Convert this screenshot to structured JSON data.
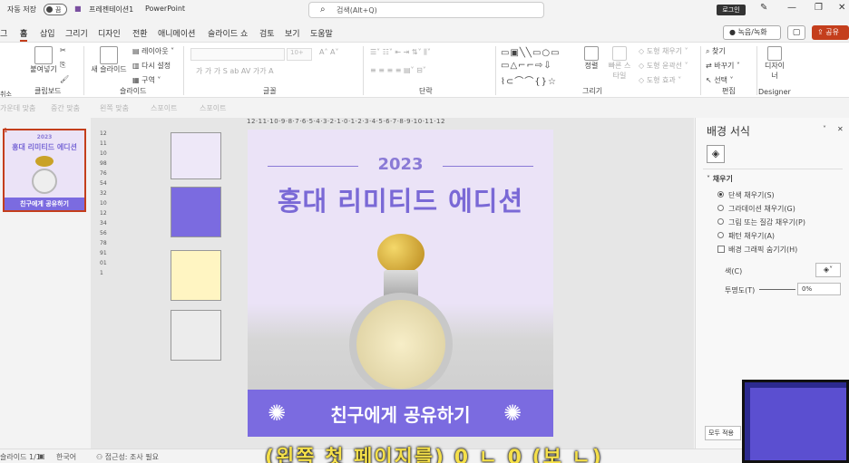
{
  "titlebar": {
    "autosave": "자동 저장",
    "autosave_state": "끔",
    "filename": "프레젠테이션1",
    "app": "PowerPoint",
    "search_placeholder": "검색(Alt+Q)",
    "login": "로그인"
  },
  "tabs": [
    "그",
    "홈",
    "삽입",
    "그리기",
    "디자인",
    "전환",
    "애니메이션",
    "슬라이드 쇼",
    "검토",
    "보기",
    "도움말"
  ],
  "actions": {
    "record": "녹음/녹화",
    "share": "공유"
  },
  "ribbon": {
    "groups": [
      "클립보드",
      "슬라이드",
      "글꼴",
      "단락",
      "그리기",
      "편집",
      "Designer"
    ],
    "clipboard": {
      "paste": "붙여넣기",
      "undo": "취소"
    },
    "slides": {
      "new": "새 슬라이드",
      "layout": "레이아웃",
      "reset": "다시 설정",
      "section": "구역"
    },
    "font": {
      "size": "10+"
    },
    "drawing": {
      "arrange": "정렬",
      "quick_styles": "빠른 스타일",
      "fill": "도형 채우기",
      "outline": "도형 윤곽선",
      "effects": "도형 효과"
    },
    "editing": {
      "find": "찾기",
      "replace": "바꾸기",
      "select": "선택"
    },
    "designer": "디자이너"
  },
  "subbar": [
    "가운데 맞춤",
    "중간 맞춤",
    "왼쪽 맞춤",
    "스포이트",
    "스포이트"
  ],
  "thumb": {
    "number": "1",
    "year": "2023",
    "title": "홍대 리미티드 에디션",
    "cta": "친구에게 공유하기"
  },
  "ruler": {
    "h": "12·11·10·9·8·7·6·5·4·3·2·1·0·1·2·3·4·5·6·7·8·9·10·11·12",
    "v": "12111098765432101234567891011"
  },
  "swatches": [
    "#eee8f8",
    "#7b6be0",
    "#fff5c2",
    "#ececec"
  ],
  "slide": {
    "year": "2023",
    "title": "홍대 리미티드 에디션",
    "cta": "친구에게 공유하기"
  },
  "format_pane": {
    "title": "배경 서식",
    "section": "채우기",
    "options": [
      "단색 채우기(S)",
      "그라데이션 채우기(G)",
      "그림 또는 질감 채우기(P)",
      "패턴 채우기(A)"
    ],
    "hide_graphics": "배경 그래픽 숨기기(H)",
    "color_label": "색(C)",
    "transparency_label": "투명도(T)",
    "transparency_value": "0%",
    "apply_all": "모두 적용"
  },
  "status": {
    "slide": "슬라이드 1/1",
    "language": "한국어",
    "accessibility": "접근성: 조사 필요"
  },
  "caption": "(왼쪽 첫 페이지를) 0 ㄴ 0 (보 ㄴ)"
}
